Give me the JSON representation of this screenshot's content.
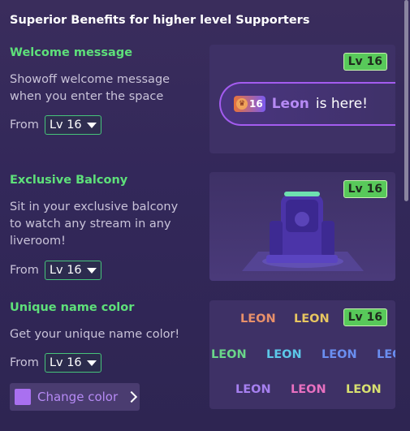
{
  "header": "Superior Benefits for higher level Supporters",
  "sections": [
    {
      "title": "Welcome message",
      "desc": [
        "Showoff welcome message",
        "when you enter the space"
      ],
      "from_label": "From",
      "level": "Lv 16",
      "badge": "Lv 16",
      "preview": {
        "level_num": "16",
        "name": "Leon",
        "suffix": "is here!"
      }
    },
    {
      "title": "Exclusive Balcony",
      "desc": [
        "Sit in your exclusive balcony",
        "to watch any stream in any",
        "liveroom!"
      ],
      "from_label": "From",
      "level": "Lv 16",
      "badge": "Lv 16"
    },
    {
      "title": "Unique name color",
      "desc": [
        "Get your unique name color!"
      ],
      "from_label": "From",
      "level": "Lv 16",
      "badge": "Lv 16",
      "change_color_label": "Change color",
      "swatch_color": "#a970f0",
      "names": [
        {
          "text": "LEON",
          "color": "#e8906a"
        },
        {
          "text": "LEON",
          "color": "#e8c660"
        },
        {
          "text": "LEON",
          "color": "#6ad68a"
        },
        {
          "text": "LEON",
          "color": "#5cc8e8"
        },
        {
          "text": "LEON",
          "color": "#6a8ef0"
        },
        {
          "text": "LEO",
          "color": "#6a8ef0"
        },
        {
          "text": "LEON",
          "color": "#a680f0"
        },
        {
          "text": "LEON",
          "color": "#e870c0"
        },
        {
          "text": "LEON",
          "color": "#d8e070"
        }
      ]
    }
  ]
}
